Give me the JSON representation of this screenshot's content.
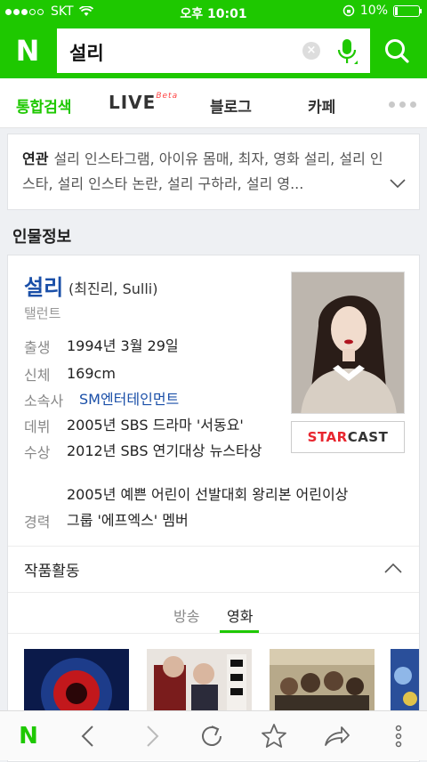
{
  "status": {
    "carrier": "SKT",
    "time": "오후 10:01",
    "battery": "10%",
    "battery_level": 0.1
  },
  "search": {
    "query": "설리",
    "clear_symbol": "×",
    "logo": "N"
  },
  "tabs": [
    {
      "label": "통합검색",
      "active": true
    },
    {
      "label": "LIVE",
      "badge": "Beta"
    },
    {
      "label": "블로그"
    },
    {
      "label": "카페"
    }
  ],
  "related": {
    "heading": "연관",
    "text": "설리 인스타그램, 아이유 몸매, 최자, 영화 설리, 설리 인스타, 설리 인스타 논란, 설리 구하라, 설리 영..."
  },
  "section_title": "인물정보",
  "person": {
    "name": "설리",
    "alias": "(최진리, Sulli)",
    "job": "탤런트",
    "rows": [
      {
        "key": "출생",
        "value": "1994년 3월 29일"
      },
      {
        "key": "신체",
        "value": "169cm"
      },
      {
        "key": "소속사",
        "value": "SM엔터테인먼트"
      },
      {
        "key": "데뷔",
        "value": "2005년 SBS 드라마 '서동요'"
      },
      {
        "key": "수상",
        "value": "2012년 SBS 연기대상 뉴스타상",
        "value2": "2005년 예쁜 어린이 선발대회 왕리본 어린이상"
      },
      {
        "key": "경력",
        "value": "그룹 '에프엑스' 멤버"
      }
    ],
    "starcast": {
      "red": "STAR",
      "dark": "CAST"
    }
  },
  "works": {
    "title": "작품활동",
    "subtabs": [
      {
        "label": "방송"
      },
      {
        "label": "영화",
        "active": true
      }
    ]
  },
  "colors": {
    "brand": "#1ec800",
    "link": "#1a4fa8",
    "starcast_red": "#e8262f"
  },
  "icons": {
    "status": [
      "signal-dots-icon",
      "wifi-icon",
      "rotation-lock-icon",
      "battery-icon"
    ],
    "search": [
      "naver-logo-icon",
      "clear-icon",
      "mic-icon",
      "search-icon"
    ],
    "bottom": [
      "naver-home-icon",
      "back-icon",
      "forward-icon",
      "refresh-icon",
      "bookmark-star-icon",
      "share-icon",
      "more-icon"
    ]
  }
}
